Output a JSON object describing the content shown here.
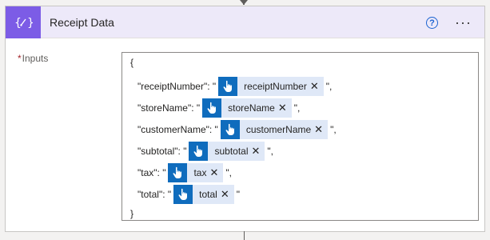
{
  "card": {
    "title": "Receipt Data"
  },
  "inputs": {
    "required_marker": "*",
    "label": "Inputs"
  },
  "editor": {
    "open_brace": "{",
    "close_brace": "}",
    "lines": [
      {
        "key": "\"receiptNumber\": \"",
        "token": "receiptNumber",
        "suffix": "\","
      },
      {
        "key": "\"storeName\": \"",
        "token": "storeName",
        "suffix": "\","
      },
      {
        "key": "\"customerName\": \"",
        "token": "customerName",
        "suffix": "\","
      },
      {
        "key": "\"subtotal\": \"",
        "token": "subtotal",
        "suffix": "\","
      },
      {
        "key": "\"tax\": \"",
        "token": "tax",
        "suffix": "\","
      },
      {
        "key": "\"total\": \"",
        "token": "total",
        "suffix": "\""
      }
    ],
    "token_remove_glyph": "✕"
  },
  "icons": {
    "action": "curly-braces-variable-icon",
    "help": "help-circle-icon",
    "more": "more-horizontal-icon",
    "token": "hand-pointer-icon",
    "remove": "close-icon"
  },
  "colors": {
    "accent": "#7c5ce6",
    "header_bg": "#ede9f9",
    "token_bg": "#dfe8f7",
    "token_icon_bg": "#0f6cbd",
    "help": "#1b63d1",
    "required": "#a4262c"
  }
}
